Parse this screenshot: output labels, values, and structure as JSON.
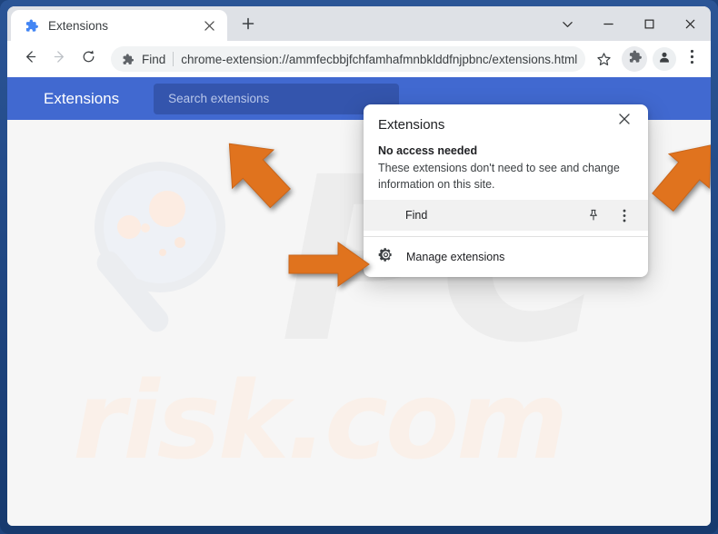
{
  "window": {
    "controls": [
      {
        "name": "tab-search",
        "glyph": "chevron-down"
      },
      {
        "name": "minimize",
        "glyph": "minimize"
      },
      {
        "name": "maximize",
        "glyph": "maximize"
      },
      {
        "name": "close",
        "glyph": "close"
      }
    ]
  },
  "tabstrip": {
    "active_tab": {
      "title": "Extensions",
      "favicon": "puzzle-piece-icon",
      "close_icon": "close-icon"
    },
    "new_tab_label": "+",
    "new_tab_icon": "plus-icon"
  },
  "toolbar": {
    "back_icon": "arrow-left-icon",
    "forward_icon": "arrow-right-icon",
    "reload_icon": "reload-icon",
    "omnibox": {
      "extension_icon": "puzzle-piece-icon",
      "scheme_label": "Find",
      "url": "chrome-extension://ammfecbbjfchfamhafmnbklddfnjpbnc/extensions.html"
    },
    "bookmark_icon": "star-icon",
    "extensions_icon": "puzzle-piece-icon",
    "profile_icon": "person-avatar-icon",
    "menu_icon": "three-dot-menu-icon"
  },
  "page": {
    "header": {
      "title": "Extensions",
      "search_placeholder": "Search extensions"
    },
    "watermark": {
      "logo_text": "PC",
      "domain_text": "risk.com"
    }
  },
  "popup": {
    "title": "Extensions",
    "close_icon": "close-icon",
    "section_heading": "No access needed",
    "section_description": "These extensions don't need to see and change information on this site.",
    "extensions": [
      {
        "name": "Find",
        "pin_icon": "pin-icon",
        "more_icon": "three-dot-menu-icon"
      }
    ],
    "manage": {
      "label": "Manage extensions",
      "icon": "gear-icon"
    }
  },
  "annotations": {
    "arrows": [
      {
        "name": "arrow-to-omnibox",
        "direction": "up-right",
        "color": "#e0731e"
      },
      {
        "name": "arrow-to-find-row",
        "direction": "right",
        "color": "#e0731e"
      },
      {
        "name": "arrow-to-ext-toolbar-icon",
        "direction": "up-left",
        "color": "#e0731e"
      }
    ]
  },
  "colors": {
    "frame_border": "#1e447e",
    "tabstrip_bg": "#dee1e6",
    "page_header_blue": "#4169d0",
    "page_search_blue": "#3455ad",
    "page_bg": "#f6f6f6",
    "annotation_orange": "#e0731e",
    "popup_row_highlight": "#f1f1f1"
  }
}
